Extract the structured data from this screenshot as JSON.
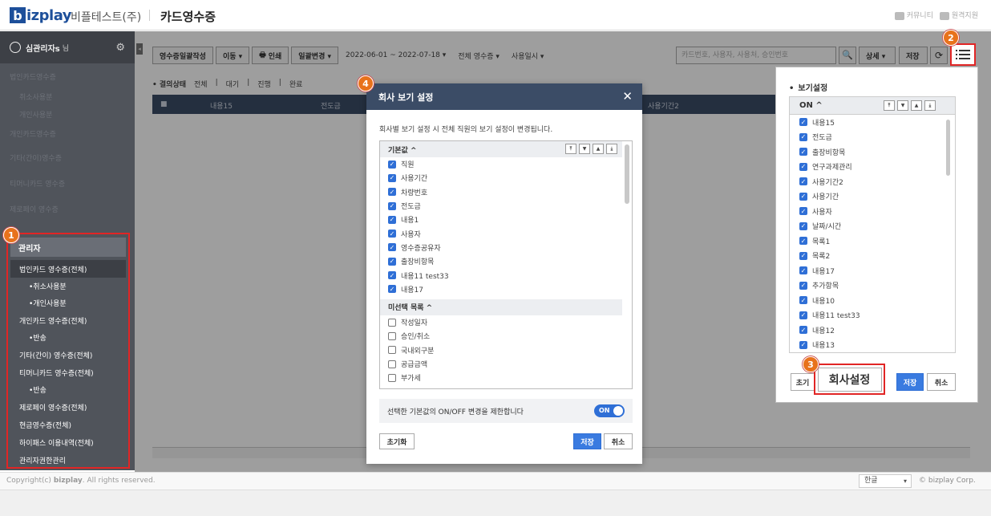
{
  "header": {
    "logo_b": "b",
    "logo_rest": "izplay",
    "company": "비플테스트(주)",
    "page_title": "카드영수증",
    "community": "커뮤니티",
    "remote_support": "원격지원"
  },
  "sidebar": {
    "user_name": "심관리자s",
    "user_suffix": "님",
    "items": [
      {
        "label": "법인카드영수증",
        "sub": false
      },
      {
        "label": "취소사용분",
        "sub": true
      },
      {
        "label": "개인사용분",
        "sub": true
      },
      {
        "label": "개인카드영수증",
        "sub": false
      },
      {
        "label": "기타(간이)영수증",
        "sub": false
      },
      {
        "label": "티머니카드 영수증",
        "sub": false
      },
      {
        "label": "제로페이 영수증",
        "sub": false
      }
    ],
    "admin": {
      "title": "관리자",
      "items": [
        "법인카드 영수증(전체)",
        "•취소사용분",
        "•개인사용분",
        "개인카드 영수증(전체)",
        "•반송",
        "기타(간이) 영수증(전체)",
        "티머니카드 영수증(전체)",
        "•반송",
        "제로페이 영수증(전체)",
        "현금영수증(전체)",
        "하이패스 이용내역(전체)",
        "관리자권한관리"
      ]
    }
  },
  "toolbar": {
    "bulk_create": "영수증일괄작성",
    "move": "이동 ▾",
    "print": "인쇄",
    "bulk_change": "일괄변경 ▾",
    "date_range": "2022-06-01 ~ 2022-07-18 ▾",
    "receipt_filter": "전체 영수증 ▾",
    "date_type": "사용일시 ▾",
    "search_placeholder": "카드번호, 사용자, 사용처, 승인번호",
    "detail": "상세 ▾",
    "save": "저장"
  },
  "status_filter": {
    "label": "결의상태",
    "options": [
      "전체",
      "대기",
      "진행",
      "완료"
    ]
  },
  "grid": {
    "columns": [
      "내용15",
      "전도금",
      "사용기간2"
    ]
  },
  "view_panel": {
    "title": "보기설정",
    "list_head": "ON ^",
    "items": [
      "내용15",
      "전도금",
      "출장비항목",
      "연구과제관리",
      "사용기간2",
      "사용기간",
      "사용자",
      "날짜/시간",
      "목록1",
      "목록2",
      "내용17",
      "추가항목",
      "내용10",
      "내용11 test33",
      "내용12",
      "내용13"
    ],
    "init": "초기",
    "company_settings": "회사설정",
    "save": "저장",
    "cancel": "취소"
  },
  "modal": {
    "title": "회사 보기 설정",
    "description": "회사별 보기 설정 시 전체 직원의 보기 설정이 변경됩니다.",
    "default_group": "기본값 ^",
    "default_items": [
      "직원",
      "사용기간",
      "차량번호",
      "전도금",
      "내용1",
      "사용자",
      "영수증공유자",
      "출장비항목",
      "내용11 test33",
      "내용17"
    ],
    "unselected_group": "미선택 목록 ^",
    "unselected_items": [
      "작성일자",
      "승인/취소",
      "국내외구분",
      "공급금액",
      "부가세"
    ],
    "toggle_text": "선택한 기본값의 ON/OFF 변경을 제한합니다",
    "toggle_state": "ON",
    "init": "초기화",
    "save": "저장",
    "cancel": "취소"
  },
  "footer": {
    "copyright_prefix": "Copyright(c)",
    "copyright_brand": "bizplay",
    "copyright_suffix": ". All rights reserved.",
    "language": "한글",
    "brand": "© bizplay Corp."
  },
  "badges": [
    "1",
    "2",
    "3",
    "4"
  ],
  "colors": {
    "brand_blue": "#1d4f9a",
    "header_navy": "#3b4c66",
    "highlight_red": "#e12525",
    "badge_orange": "#e8721c",
    "accent_blue": "#2f6fd6"
  }
}
